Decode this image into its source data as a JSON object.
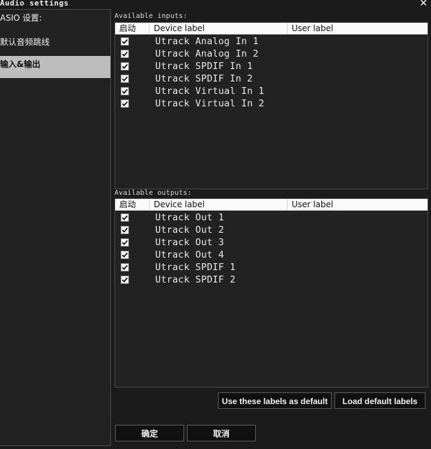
{
  "window": {
    "title": "Audio settings",
    "close_glyph": "✕"
  },
  "sidebar": {
    "items": [
      {
        "label": "ASIO 设置:"
      },
      {
        "label": "默认音频跳线"
      },
      {
        "label": "输入&输出",
        "active": true
      }
    ]
  },
  "inputs": {
    "section_label": "Available inputs:",
    "columns": {
      "enable": "启动",
      "device": "Device label",
      "user": "User label"
    },
    "rows": [
      {
        "checked": true,
        "device": "Utrack Analog In 1",
        "user": ""
      },
      {
        "checked": true,
        "device": "Utrack Analog In 2",
        "user": ""
      },
      {
        "checked": true,
        "device": "Utrack SPDIF In 1",
        "user": ""
      },
      {
        "checked": true,
        "device": "Utrack SPDIF In 2",
        "user": ""
      },
      {
        "checked": true,
        "device": "Utrack Virtual In 1",
        "user": ""
      },
      {
        "checked": true,
        "device": "Utrack Virtual In 2",
        "user": ""
      }
    ]
  },
  "outputs": {
    "section_label": "Available outputs:",
    "columns": {
      "enable": "启动",
      "device": "Device label",
      "user": "User label"
    },
    "rows": [
      {
        "checked": true,
        "device": "Utrack Out 1",
        "user": ""
      },
      {
        "checked": true,
        "device": "Utrack Out 2",
        "user": ""
      },
      {
        "checked": true,
        "device": "Utrack Out 3",
        "user": ""
      },
      {
        "checked": true,
        "device": "Utrack Out 4",
        "user": ""
      },
      {
        "checked": true,
        "device": "Utrack SPDIF 1",
        "user": ""
      },
      {
        "checked": true,
        "device": "Utrack SPDIF 2",
        "user": ""
      }
    ]
  },
  "buttons": {
    "use_default": "Use these labels as default",
    "load_default": "Load default labels",
    "ok": "确定",
    "cancel": "取消"
  },
  "colors": {
    "background": "#1b1b1b",
    "panel": "#222222",
    "active_item": "#bdbdbd",
    "header": "#fafafa"
  }
}
